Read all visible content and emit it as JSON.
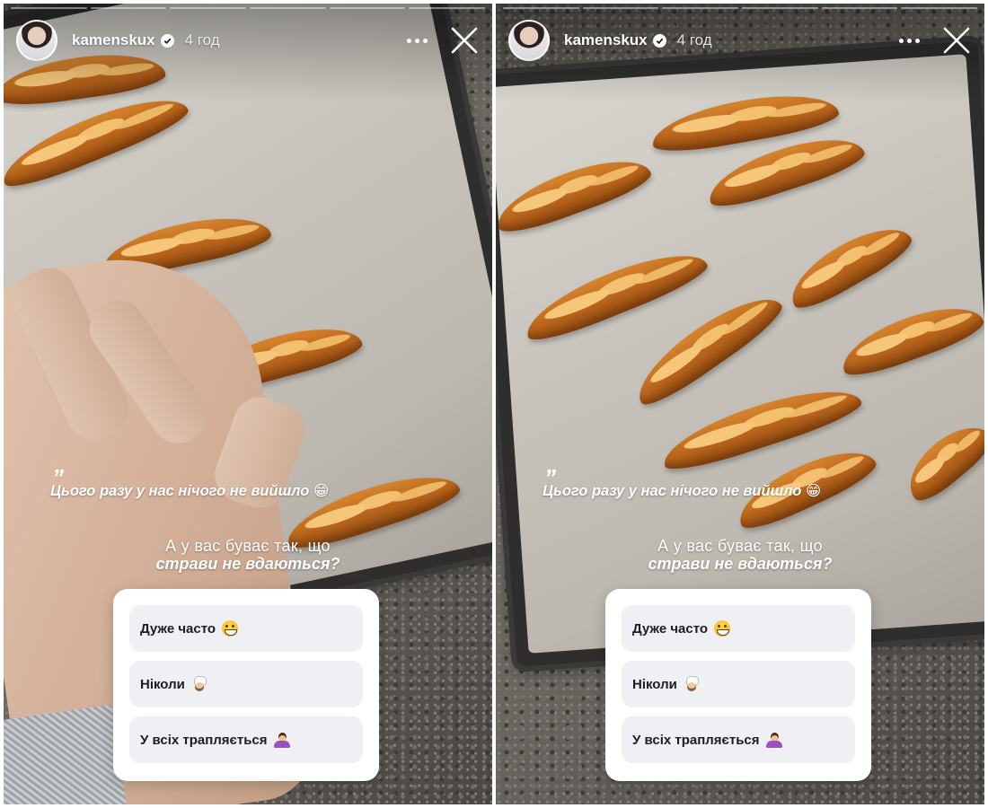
{
  "stories": [
    {
      "id": "left",
      "progress_total": 6,
      "progress_done": 0,
      "header": {
        "username": "kamenskux",
        "time": "4 год"
      },
      "caption": {
        "quote": "”",
        "text": "Цього разу у нас нічого не вийшло 😁"
      },
      "question": {
        "line1": "А у вас буває так, що",
        "line2": "страви не вдаються?"
      },
      "poll": [
        {
          "label": "Дуже часто",
          "icon": "grinning-face-icon"
        },
        {
          "label": "Ніколи",
          "icon": "cook-icon"
        },
        {
          "label": "У всіх трапляється",
          "icon": "person-shrugging-icon"
        }
      ]
    },
    {
      "id": "right",
      "progress_total": 6,
      "progress_done": 0,
      "header": {
        "username": "kamenskux",
        "time": "4 год"
      },
      "caption": {
        "quote": "”",
        "text": "Цього разу у нас нічого не вийшло 😁"
      },
      "question": {
        "line1": "А у вас буває так, що",
        "line2": "страви не вдаються?"
      },
      "poll": [
        {
          "label": "Дуже часто",
          "icon": "grinning-face-icon"
        },
        {
          "label": "Ніколи",
          "icon": "cook-icon"
        },
        {
          "label": "У всіх трапляється",
          "icon": "person-shrugging-icon"
        }
      ]
    }
  ],
  "colors": {
    "poll_bg": "#ffffff",
    "option_bg": "#eff0f3",
    "text_white": "#ffffff"
  }
}
